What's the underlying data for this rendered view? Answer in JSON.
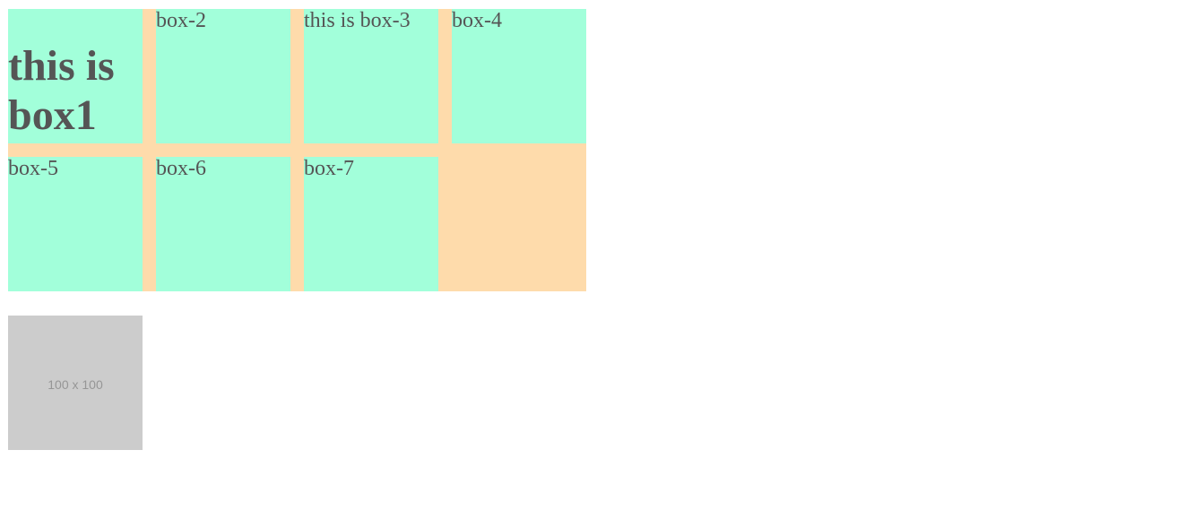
{
  "colors": {
    "container_bg": "#fedbab",
    "box_bg": "#a2ffda",
    "text": "#555555",
    "placeholder_bg": "#cccccc",
    "placeholder_text": "#969696"
  },
  "boxes": [
    {
      "label": "this is box1"
    },
    {
      "label": "box-2"
    },
    {
      "label": "this is box-3"
    },
    {
      "label": "box-4"
    },
    {
      "label": "box-5"
    },
    {
      "label": "box-6"
    },
    {
      "label": "box-7"
    }
  ],
  "placeholder_image": {
    "text": "100 x 100"
  }
}
